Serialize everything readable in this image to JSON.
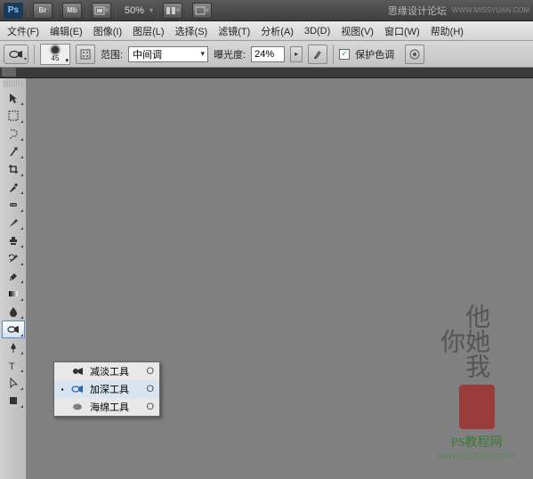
{
  "top": {
    "ps": "Ps",
    "br": "Br",
    "mb": "Mb",
    "zoom": "50%",
    "brand_text": "思缘设计论坛",
    "brand_url": "WWW.MISSYUAN.COM"
  },
  "menu": {
    "items": [
      "文件(F)",
      "编辑(E)",
      "图像(I)",
      "图层(L)",
      "选择(S)",
      "滤镜(T)",
      "分析(A)",
      "3D(D)",
      "视图(V)",
      "窗口(W)",
      "帮助(H)"
    ]
  },
  "options": {
    "brush_size": "45",
    "range_label": "范围:",
    "range_value": "中间调",
    "exposure_label": "曝光度:",
    "exposure_value": "24%",
    "protect_tones": "保护色调",
    "protect_checked": "✓"
  },
  "flyout": {
    "items": [
      {
        "mark": "",
        "icon": "dodge",
        "label": "减淡工具",
        "key": "O"
      },
      {
        "mark": "▪",
        "icon": "burn",
        "label": "加深工具",
        "key": "O"
      },
      {
        "mark": "",
        "icon": "sponge",
        "label": "海绵工具",
        "key": "O"
      }
    ]
  },
  "watermark": {
    "calligraphy": "他她我你",
    "text": "PS教程网",
    "url": "www.tata580.com"
  }
}
